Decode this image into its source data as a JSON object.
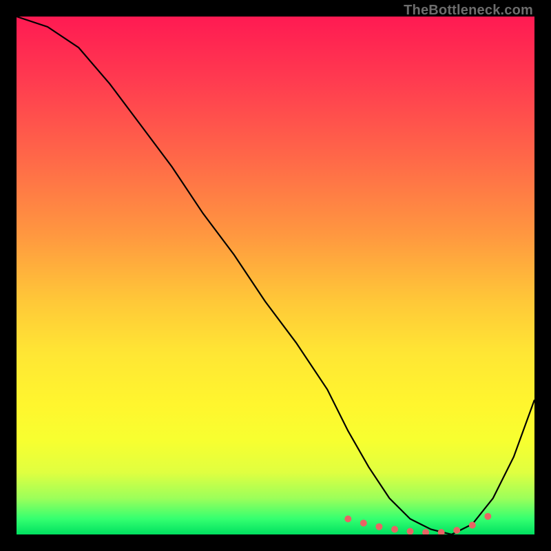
{
  "watermark": "TheBottleneck.com",
  "chart_data": {
    "type": "line",
    "title": "",
    "xlabel": "",
    "ylabel": "",
    "xlim": [
      0,
      100
    ],
    "ylim": [
      0,
      100
    ],
    "series": [
      {
        "name": "bottleneck-curve",
        "x": [
          0,
          6,
          12,
          18,
          24,
          30,
          36,
          42,
          48,
          54,
          60,
          64,
          68,
          72,
          76,
          80,
          84,
          88,
          92,
          96,
          100
        ],
        "values": [
          100,
          98,
          94,
          87,
          79,
          71,
          62,
          54,
          45,
          37,
          28,
          20,
          13,
          7,
          3,
          1,
          0,
          2,
          7,
          15,
          26
        ]
      }
    ],
    "markers": {
      "name": "highlight-range",
      "x": [
        64,
        67,
        70,
        73,
        76,
        79,
        82,
        85,
        88,
        91
      ],
      "values": [
        3,
        2.2,
        1.5,
        1.0,
        0.6,
        0.4,
        0.4,
        0.8,
        1.8,
        3.5
      ]
    },
    "gradient_stops": [
      {
        "pos": 0,
        "color": "#ff1a52"
      },
      {
        "pos": 12,
        "color": "#ff3a50"
      },
      {
        "pos": 28,
        "color": "#ff6a48"
      },
      {
        "pos": 42,
        "color": "#ff9740"
      },
      {
        "pos": 55,
        "color": "#ffc838"
      },
      {
        "pos": 65,
        "color": "#ffe634"
      },
      {
        "pos": 75,
        "color": "#fff62e"
      },
      {
        "pos": 82,
        "color": "#f7ff30"
      },
      {
        "pos": 88,
        "color": "#e0ff40"
      },
      {
        "pos": 93,
        "color": "#9cff5a"
      },
      {
        "pos": 97,
        "color": "#34ff70"
      },
      {
        "pos": 100,
        "color": "#00e060"
      }
    ]
  }
}
